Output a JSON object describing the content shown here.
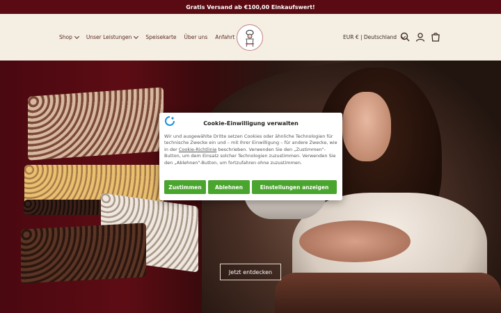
{
  "announcement": "Gratis Versand ab €100,00 Einkaufswert!",
  "nav": {
    "items": [
      {
        "label": "Shop"
      },
      {
        "label": "Unser Leistungen"
      },
      {
        "label": "Speisekarte"
      },
      {
        "label": "Über uns"
      },
      {
        "label": "Anfahrt"
      }
    ]
  },
  "locale": "EUR € | Deutschland",
  "icons": [
    "search-icon",
    "account-icon",
    "cart-icon",
    "chevron-down-icon",
    "logo"
  ],
  "hero": {
    "cta": "Jetzt entdecken"
  },
  "cookie": {
    "title": "Cookie-Einwilligung verwalten",
    "body_before_link": "Wir und ausgewählte Dritte setzen Cookies oder ähnliche Technologien für technische Zwecke ein und – mit Ihrer Einwilligung – für andere Zwecke, wie in der ",
    "link": "Cookie-Richtlinie",
    "body_after_link": " beschrieben. Verwenden Sie den „Zustimmen\"-Button, um dem Einsatz solcher Technologien zuzustimmen. Verwenden Sie den „Ablehnen\"-Button, um fortzufahren ohne zuzustimmen.",
    "accept": "Zustimmen",
    "reject": "Ablehnen",
    "settings": "Einstellungen anzeigen"
  },
  "colors": {
    "announcement_bg": "#5a0a12",
    "header_bg": "#f5eee2",
    "button_green": "#4aa52e",
    "nav_text": "#5a2a24"
  }
}
